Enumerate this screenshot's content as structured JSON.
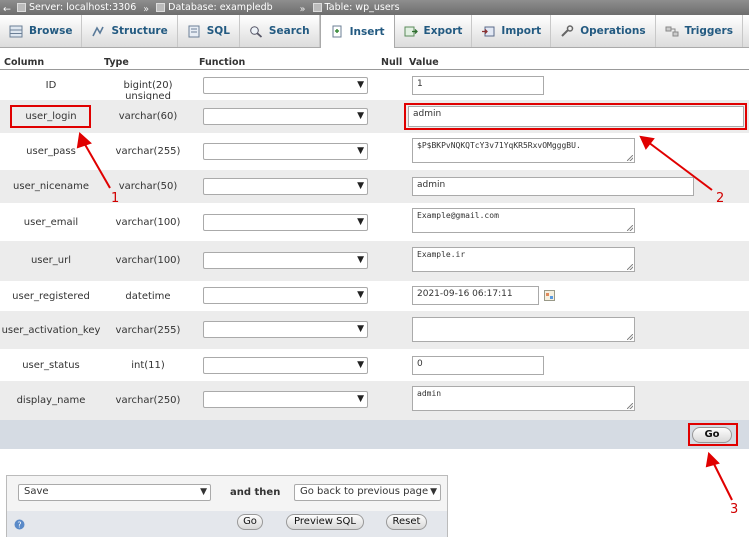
{
  "breadcrumb": {
    "back": "←",
    "server": "Server: localhost:3306",
    "database": "Database: exampledb",
    "table": "Table: wp_users",
    "separator": "»"
  },
  "tabs": [
    {
      "label": "Browse",
      "icon": "browse-icon"
    },
    {
      "label": "Structure",
      "icon": "structure-icon"
    },
    {
      "label": "SQL",
      "icon": "sql-icon"
    },
    {
      "label": "Search",
      "icon": "search-icon"
    },
    {
      "label": "Insert",
      "icon": "insert-icon",
      "active": true
    },
    {
      "label": "Export",
      "icon": "export-icon"
    },
    {
      "label": "Import",
      "icon": "import-icon"
    },
    {
      "label": "Operations",
      "icon": "wrench-icon"
    },
    {
      "label": "Triggers",
      "icon": "triggers-icon"
    }
  ],
  "columns_header": {
    "column": "Column",
    "type": "Type",
    "function": "Function",
    "null": "Null",
    "value": "Value"
  },
  "rows": [
    {
      "column": "ID",
      "type": "bigint(20) unsigned",
      "value": "1"
    },
    {
      "column": "user_login",
      "type": "varchar(60)",
      "value": "admin"
    },
    {
      "column": "user_pass",
      "type": "varchar(255)",
      "value": "$P$BKPvNQKQTcY3v71YqKR5RxvOMgggBU."
    },
    {
      "column": "user_nicename",
      "type": "varchar(50)",
      "value": "admin"
    },
    {
      "column": "user_email",
      "type": "varchar(100)",
      "value": "Example@gmail.com"
    },
    {
      "column": "user_url",
      "type": "varchar(100)",
      "value": "Example.ir"
    },
    {
      "column": "user_registered",
      "type": "datetime",
      "value": "2021-09-16 06:17:11"
    },
    {
      "column": "user_activation_key",
      "type": "varchar(255)",
      "value": ""
    },
    {
      "column": "user_status",
      "type": "int(11)",
      "value": "0"
    },
    {
      "column": "display_name",
      "type": "varchar(250)",
      "value": "admin"
    }
  ],
  "go_button": "Go",
  "bottom": {
    "action_select": "Save",
    "and_then": "and then",
    "then_select": "Go back to previous page",
    "go": "Go",
    "preview_sql": "Preview SQL",
    "reset": "Reset"
  },
  "annotations": {
    "one": "1",
    "two": "2",
    "three": "3"
  },
  "colors": {
    "annotation_red": "#e00000",
    "tab_text": "#235a81",
    "alt_row": "#ececec",
    "go_bar": "#d5dbe3"
  }
}
